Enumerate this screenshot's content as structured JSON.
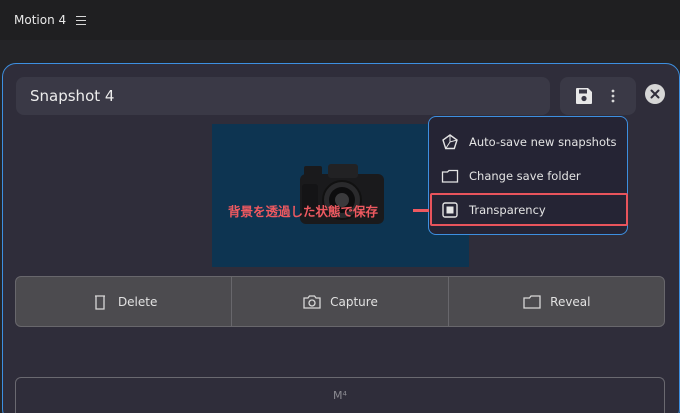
{
  "app": {
    "title": "Motion 4"
  },
  "dialog": {
    "snapshot_name": "Snapshot 4",
    "bottom_label": "M⁴"
  },
  "menu": {
    "items": [
      {
        "label": "Auto-save new snapshots",
        "icon": "pentagon-icon"
      },
      {
        "label": "Change save folder",
        "icon": "folder-icon"
      },
      {
        "label": "Transparency",
        "icon": "transparency-checkbox-icon"
      }
    ]
  },
  "annotation": {
    "text": "背景を透過した状態で保存"
  },
  "buttons": {
    "delete": "Delete",
    "capture": "Capture",
    "reveal": "Reveal"
  },
  "colors": {
    "accent": "#3d8fe0",
    "annotation": "#ee5960",
    "preview_bg": "#0d3451"
  }
}
